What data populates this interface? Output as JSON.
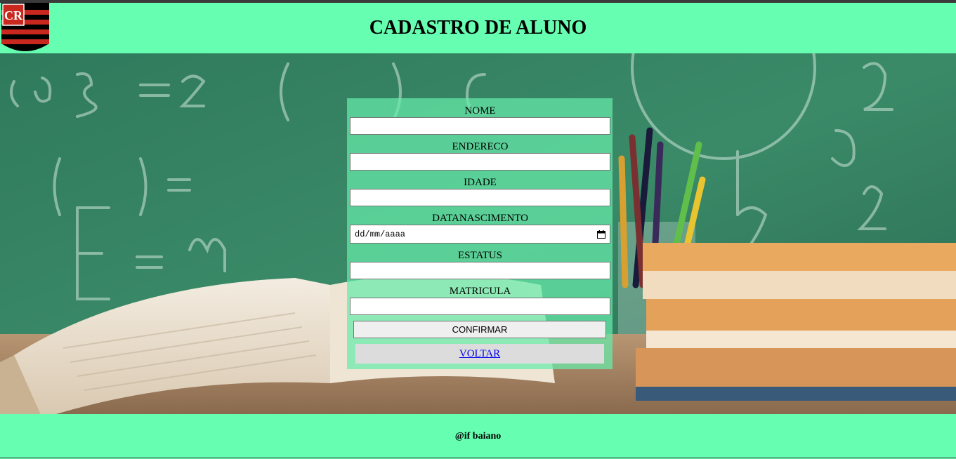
{
  "header": {
    "title": "CADASTRO DE ALUNO",
    "logo_icon": "flamengo-crest-icon"
  },
  "form": {
    "fields": [
      {
        "label": "NOME",
        "value": ""
      },
      {
        "label": "ENDERECO",
        "value": ""
      },
      {
        "label": "IDADE",
        "value": ""
      },
      {
        "label": "DATANASCIMENTO",
        "placeholder": "dd/mm/aaaa"
      },
      {
        "label": "ESTATUS",
        "value": ""
      },
      {
        "label": "MATRICULA",
        "value": ""
      }
    ],
    "confirm_label": "CONFIRMAR",
    "back_label": "VOLTAR"
  },
  "footer": {
    "text": "@if baiano"
  },
  "colors": {
    "accent": "#66ffb2",
    "link": "#0000ee"
  }
}
